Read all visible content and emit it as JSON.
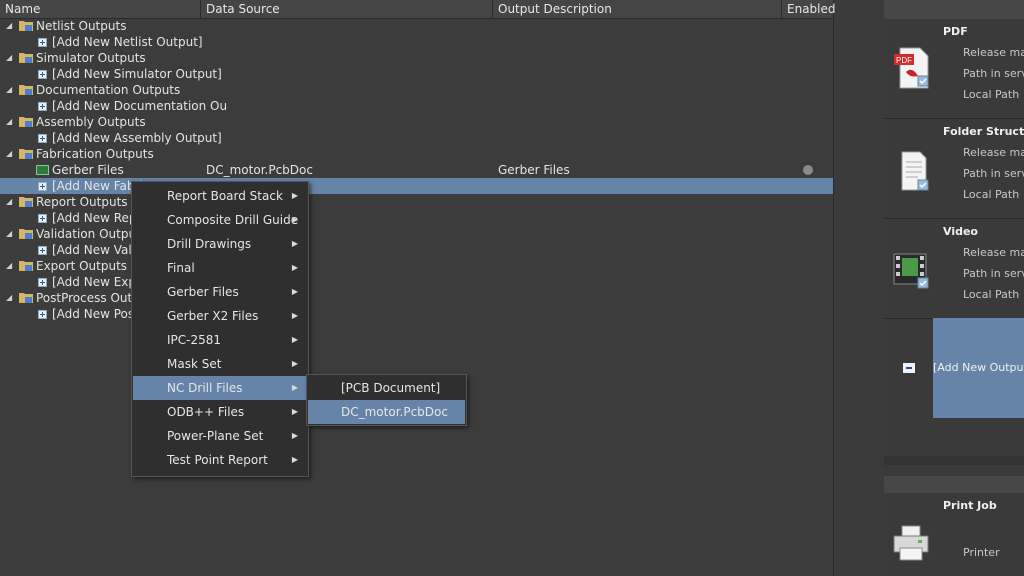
{
  "columns": {
    "name": "Name",
    "data_source": "Data Source",
    "output_description": "Output Description",
    "enabled": "Enabled"
  },
  "tree": {
    "rows": [
      {
        "label": "Netlist Outputs"
      },
      {
        "label": "[Add New Netlist Output]"
      },
      {
        "label": "Simulator Outputs"
      },
      {
        "label": "[Add New Simulator Output]"
      },
      {
        "label": "Documentation Outputs"
      },
      {
        "label": "[Add New Documentation Ou"
      },
      {
        "label": "Assembly Outputs"
      },
      {
        "label": "[Add New Assembly Output]"
      },
      {
        "label": "Fabrication Outputs"
      },
      {
        "label": "Gerber Files",
        "data_source": "DC_motor.PcbDoc",
        "description": "Gerber Files"
      },
      {
        "label": "[Add New Fabri"
      },
      {
        "label": "Report Outputs"
      },
      {
        "label": "[Add New Repo"
      },
      {
        "label": "Validation Outputs"
      },
      {
        "label": "[Add New Valid"
      },
      {
        "label": "Export Outputs"
      },
      {
        "label": "[Add New Expo"
      },
      {
        "label": "PostProcess Outpu"
      },
      {
        "label": "[Add New PostP"
      }
    ]
  },
  "context_menu": {
    "items": [
      {
        "label": "Report Board Stack"
      },
      {
        "label": "Composite Drill Guide"
      },
      {
        "label": "Drill Drawings"
      },
      {
        "label": "Final"
      },
      {
        "label": "Gerber Files"
      },
      {
        "label": "Gerber X2 Files"
      },
      {
        "label": "IPC-2581"
      },
      {
        "label": "Mask Set"
      },
      {
        "label": "NC Drill Files"
      },
      {
        "label": "ODB++ Files"
      },
      {
        "label": "Power-Plane Set"
      },
      {
        "label": "Test Point Report"
      }
    ],
    "highlighted": "NC Drill Files"
  },
  "submenu": {
    "items": [
      {
        "label": "[PCB Document]"
      },
      {
        "label": "DC_motor.PcbDoc"
      }
    ],
    "highlighted": "DC_motor.PcbDoc"
  },
  "right_panel": {
    "sections": [
      {
        "title": "PDF",
        "fields": [
          "Release mar",
          "Path in serv",
          "Local Path"
        ]
      },
      {
        "title": "Folder Structure",
        "fields": [
          "Release mar",
          "Path in serv",
          "Local Path"
        ]
      },
      {
        "title": "Video",
        "fields": [
          "Release mar",
          "Path in serv",
          "Local Path"
        ]
      }
    ],
    "add_new_output": "[Add New Output",
    "print_job": {
      "title": "Print Job",
      "field": "Printer"
    }
  },
  "colors": {
    "selection": "#6584a8",
    "background": "#3c3c3c",
    "menu_background": "#2f2f2f"
  }
}
